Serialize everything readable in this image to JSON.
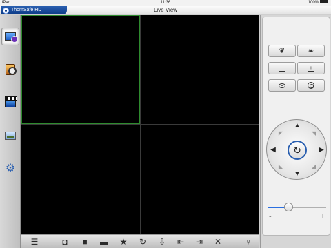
{
  "status": {
    "device": "iPad",
    "time": "11:36",
    "battery": "100%"
  },
  "app": {
    "name": "ThomSafe HD",
    "title": "Live View"
  },
  "sidebar": {
    "items": [
      {
        "name": "live-view",
        "icon": "monitor-icon",
        "active": true
      },
      {
        "name": "playback",
        "icon": "film-reel-icon",
        "active": false
      },
      {
        "name": "recordings",
        "icon": "clapperboard-icon",
        "active": false
      },
      {
        "name": "pictures",
        "icon": "picture-icon",
        "active": false
      },
      {
        "name": "settings",
        "icon": "gear-icon",
        "active": false
      }
    ]
  },
  "grid": {
    "layout": "2x2",
    "selected_cell": 1
  },
  "toolbar": {
    "icons": [
      "layout-list-icon",
      "snapshot-icon",
      "record-icon",
      "gallery-icon",
      "favorite-star-icon",
      "rotate-icon",
      "import-icon",
      "previous-icon",
      "next-icon",
      "fullscreen-icon",
      "audio-icon"
    ]
  },
  "ptz": {
    "focus_buttons": [
      "focus-near-icon",
      "focus-far-icon"
    ],
    "zoom_buttons": [
      "zoom-in-icon",
      "zoom-out-icon"
    ],
    "iris_buttons": [
      "iris-close-icon",
      "iris-open-icon"
    ],
    "slider_min": "-",
    "slider_max": "+",
    "slider_value": 0.35,
    "colors": {
      "accent": "#2a5fb0",
      "selected_border": "#2e8b2e"
    }
  }
}
